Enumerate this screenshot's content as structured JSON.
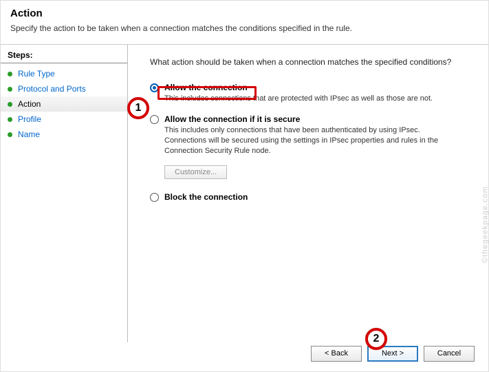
{
  "header": {
    "title": "Action",
    "subtitle": "Specify the action to be taken when a connection matches the conditions specified in the rule."
  },
  "sidebar": {
    "title": "Steps:",
    "items": [
      {
        "label": "Rule Type",
        "current": false
      },
      {
        "label": "Protocol and Ports",
        "current": false
      },
      {
        "label": "Action",
        "current": true
      },
      {
        "label": "Profile",
        "current": false
      },
      {
        "label": "Name",
        "current": false
      }
    ]
  },
  "main": {
    "question": "What action should be taken when a connection matches the specified conditions?",
    "options": [
      {
        "label": "Allow the connection",
        "desc": "This includes connections that are protected with IPsec as well as those are not.",
        "selected": true
      },
      {
        "label": "Allow the connection if it is secure",
        "desc": "This includes only connections that have been authenticated by using IPsec.  Connections will be secured using the settings in IPsec properties and rules in the Connection Security Rule node.",
        "selected": false
      },
      {
        "label": "Block the connection",
        "desc": "",
        "selected": false
      }
    ],
    "customize_label": "Customize..."
  },
  "footer": {
    "back": "< Back",
    "next": "Next >",
    "cancel": "Cancel"
  },
  "annotations": {
    "one": "1",
    "two": "2"
  },
  "watermark": "©thegeekpage.com"
}
